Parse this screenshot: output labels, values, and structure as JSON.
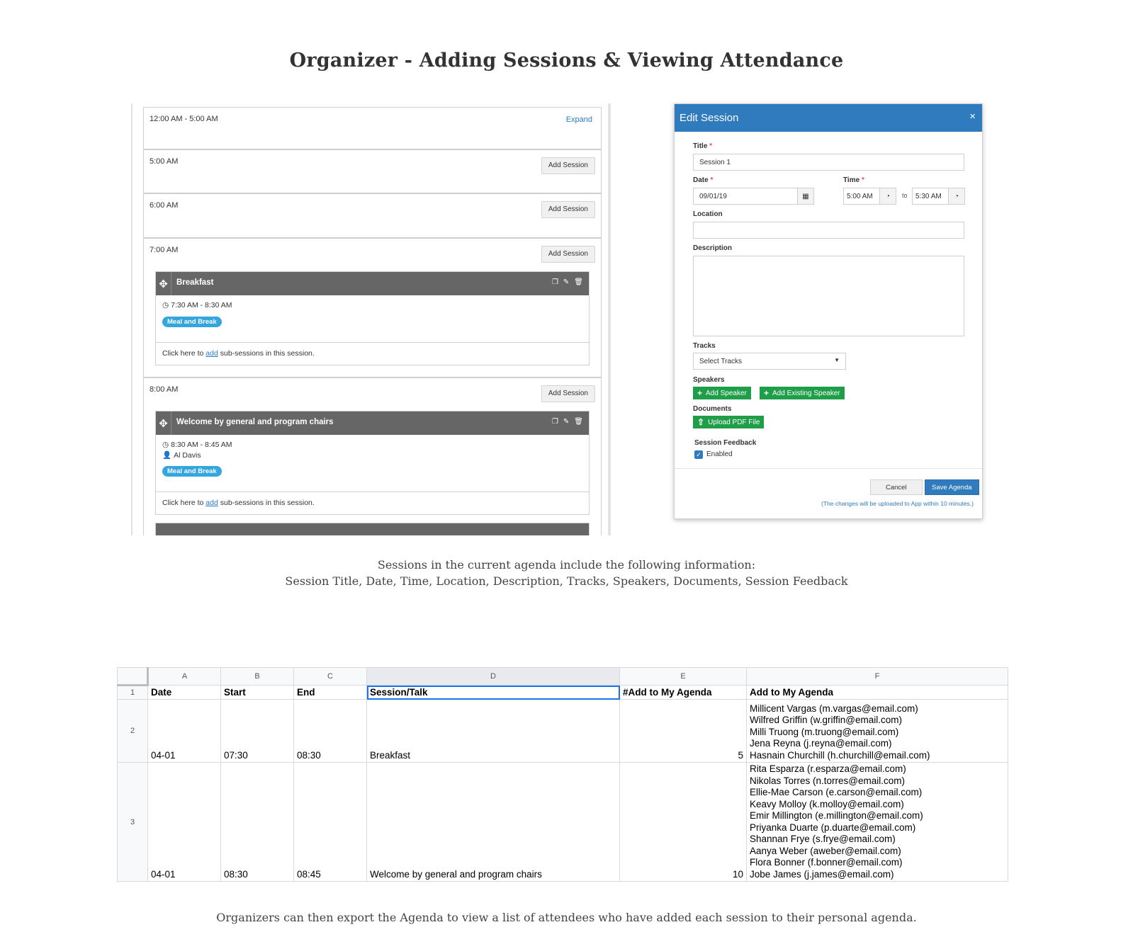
{
  "page": {
    "title": "Organizer - Adding Sessions & Viewing Attendance",
    "caption1_line1": "Sessions in the current agenda include the following information:",
    "caption1_line2": "Session Title, Date, Time, Location, Description, Tracks, Speakers, Documents, Session Feedback",
    "caption2": "Organizers can then export the Agenda to view a list of attendees who have added each session to their personal agenda."
  },
  "agenda": {
    "add_session_label": "Add Session",
    "expand_label": "Expand",
    "slots": [
      "12:00 AM - 5:00 AM",
      "5:00 AM",
      "6:00 AM",
      "7:00 AM",
      "8:00 AM"
    ],
    "subsessions_prefix": "Click here to ",
    "subsessions_link": "add",
    "subsessions_suffix": " sub-sessions in this session.",
    "sessions": [
      {
        "title": "Breakfast",
        "time": "7:30 AM - 8:30 AM",
        "speaker": "",
        "track": "Meal and Break"
      },
      {
        "title": "Welcome by general and program chairs",
        "time": "8:30 AM - 8:45 AM",
        "speaker": "Al Davis",
        "track": "Meal and Break"
      }
    ]
  },
  "modal": {
    "title": "Edit Session",
    "close_glyph": "×",
    "title_label": "Title",
    "title_value": "Session 1",
    "date_label": "Date",
    "date_value": "09/01/19",
    "time_label": "Time",
    "time_start": "5:00 AM",
    "time_to": "to",
    "time_end": "5:30 AM",
    "location_label": "Location",
    "location_value": "",
    "description_label": "Description",
    "description_value": "",
    "tracks_label": "Tracks",
    "tracks_placeholder": "Select Tracks",
    "speakers_label": "Speakers",
    "add_speaker": "Add Speaker",
    "add_existing_speaker": "Add Existing Speaker",
    "documents_label": "Documents",
    "upload_pdf": "Upload PDF File",
    "feedback_label": "Session Feedback",
    "feedback_enabled": "Enabled",
    "cancel": "Cancel",
    "save": "Save Agenda",
    "note": "(The changes will be uploaded to App within 10 minutes.)",
    "required_mark": "*",
    "colors": {
      "header": "#2f7bbd",
      "green": "#1f9e4a"
    }
  },
  "sheet": {
    "columns": [
      "A",
      "B",
      "C",
      "D",
      "E",
      "F"
    ],
    "headers": [
      "Date",
      "Start",
      "End",
      "Session/Talk",
      "#Add to My Agenda",
      "Add to My Agenda"
    ],
    "rows": [
      {
        "row_num": "2",
        "date": "04-01",
        "start": "07:30",
        "end": "08:30",
        "session": "Breakfast",
        "count": "5",
        "attendees": [
          "Millicent Vargas (m.vargas@email.com)",
          "Wilfred Griffin (w.griffin@email.com)",
          "Milli Truong (m.truong@email.com)",
          "Jena Reyna (j.reyna@email.com)",
          "Hasnain Churchill (h.churchill@email.com)"
        ]
      },
      {
        "row_num": "3",
        "date": "04-01",
        "start": "08:30",
        "end": "08:45",
        "session": "Welcome by general and program chairs",
        "count": "10",
        "attendees": [
          "Rita Esparza (r.esparza@email.com)",
          "Nikolas Torres (n.torres@email.com)",
          "Ellie-Mae Carson (e.carson@email.com)",
          "Keavy Molloy (k.molloy@email.com)",
          "Emir Millington (e.millington@email.com)",
          "Priyanka Duarte (p.duarte@email.com)",
          "Shannan Frye (s.frye@email.com)",
          "Aanya Weber (aweber@email.com)",
          "Flora Bonner (f.bonner@email.com)",
          "Jobe James (j.james@email.com)"
        ]
      }
    ],
    "header_row_num": "1"
  }
}
